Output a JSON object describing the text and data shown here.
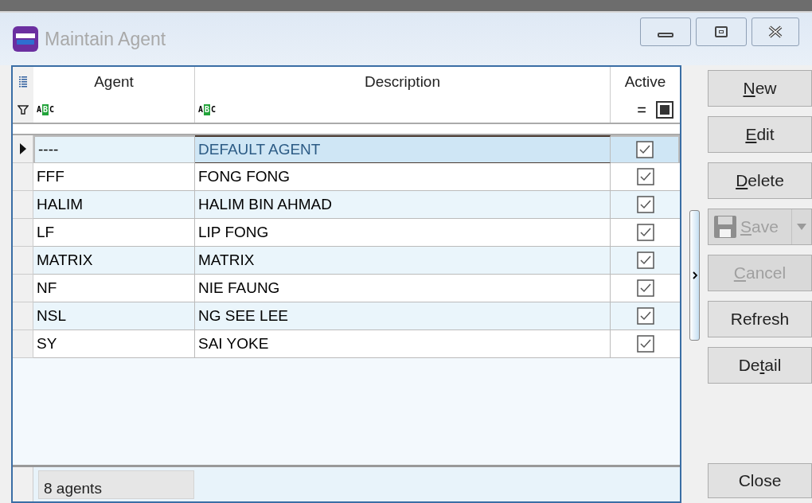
{
  "window": {
    "title": "Maintain Agent"
  },
  "table": {
    "columns": [
      {
        "label": "Agent",
        "kind": "text",
        "filter_glyphs": {
          "a": "A",
          "b": "B",
          "c": "C"
        }
      },
      {
        "label": "Description",
        "kind": "text",
        "filter_glyphs": {
          "a": "A",
          "b": "B",
          "c": "C"
        }
      },
      {
        "label": "Active",
        "kind": "check",
        "filter_glyphs": {
          "equals": "="
        }
      }
    ],
    "rows": [
      {
        "agent": "----",
        "description": "DEFAULT AGENT",
        "active": true,
        "selected": true
      },
      {
        "agent": "FFF",
        "description": "FONG FONG",
        "active": true,
        "selected": false
      },
      {
        "agent": "HALIM",
        "description": "HALIM BIN AHMAD",
        "active": true,
        "selected": false
      },
      {
        "agent": "LF",
        "description": "LIP FONG",
        "active": true,
        "selected": false
      },
      {
        "agent": "MATRIX",
        "description": "MATRIX",
        "active": true,
        "selected": false
      },
      {
        "agent": "NF",
        "description": "NIE FAUNG",
        "active": true,
        "selected": false
      },
      {
        "agent": "NSL",
        "description": "NG SEE LEE",
        "active": true,
        "selected": false
      },
      {
        "agent": "SY",
        "description": "SAI YOKE",
        "active": true,
        "selected": false
      }
    ],
    "footer": "8 agents"
  },
  "buttons": [
    {
      "access_key": "N",
      "label_after": "ew",
      "disabled": false,
      "kind": "plain"
    },
    {
      "access_key": "E",
      "label_after": "dit",
      "disabled": false,
      "kind": "plain"
    },
    {
      "access_key": "D",
      "label_after": "elete",
      "disabled": false,
      "kind": "plain"
    },
    {
      "access_key": "S",
      "label_after": "ave",
      "disabled": true,
      "kind": "split"
    },
    {
      "access_key": "C",
      "label_after": "ancel",
      "disabled": true,
      "kind": "plain"
    },
    {
      "label_before": "Refresh",
      "disabled": false,
      "kind": "plain"
    },
    {
      "label_before": "De",
      "access_key": "t",
      "label_after": "ail",
      "disabled": false,
      "kind": "plain"
    }
  ],
  "close_button": {
    "label": "Close"
  }
}
